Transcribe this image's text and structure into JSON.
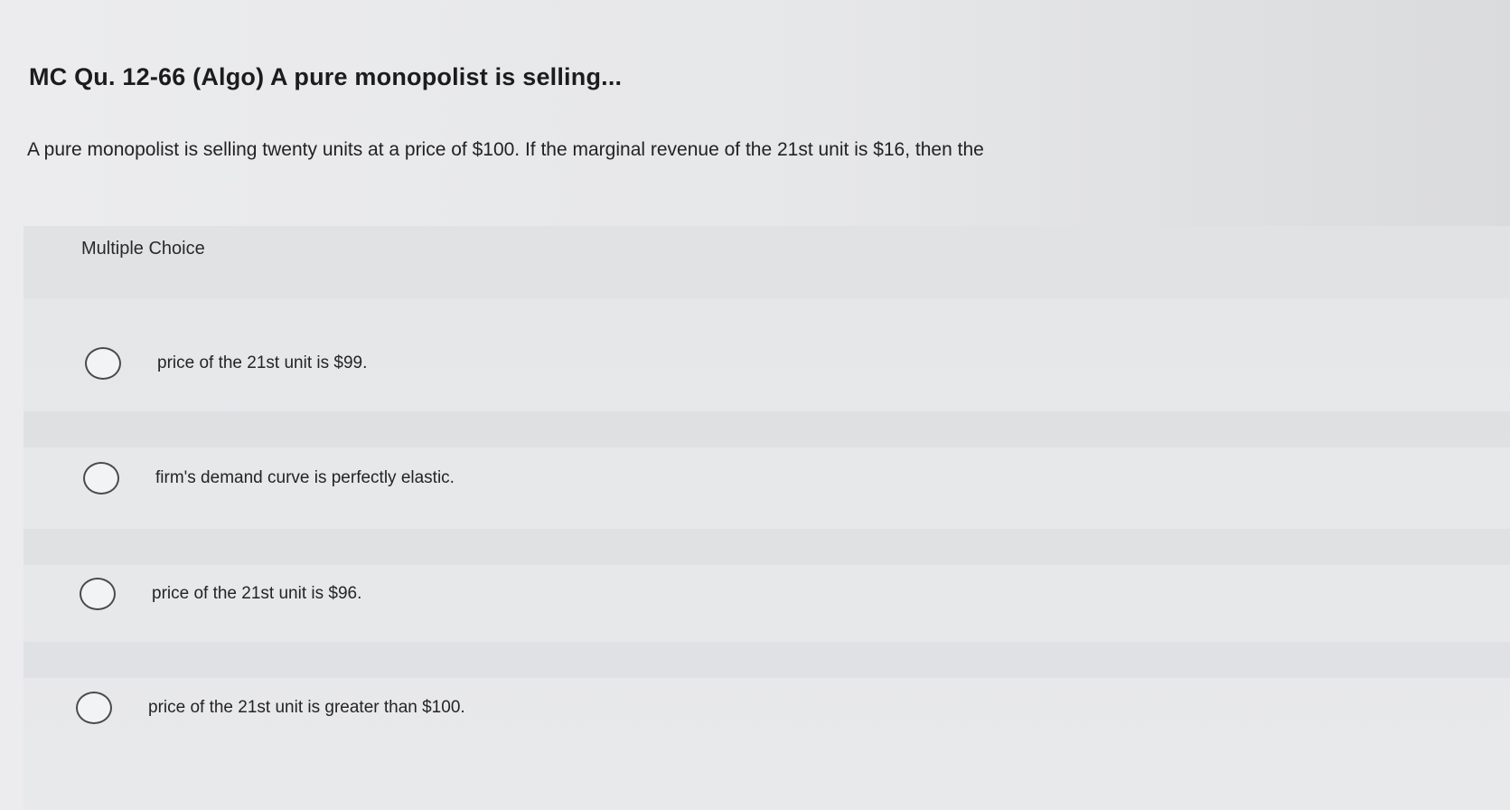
{
  "question": {
    "title": "MC Qu. 12-66 (Algo) A pure monopolist is selling...",
    "text": "A pure monopolist is selling twenty units at a price of $100. If the marginal revenue of the 21st unit is $16, then the"
  },
  "choices": {
    "heading": "Multiple Choice",
    "options": [
      {
        "label": "price of the 21st unit is $99."
      },
      {
        "label": "firm's demand curve is perfectly elastic."
      },
      {
        "label": "price of the 21st unit is $96."
      },
      {
        "label": "price of the 21st unit is greater than $100."
      }
    ]
  }
}
